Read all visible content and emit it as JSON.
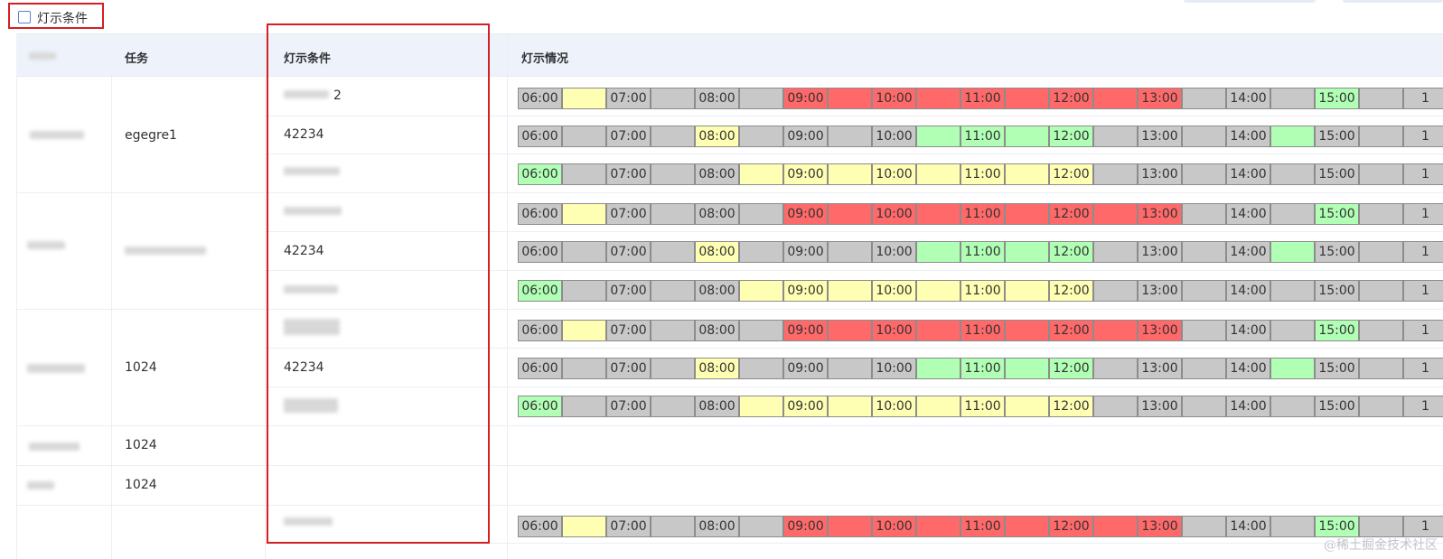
{
  "toggle": {
    "label": "灯示条件",
    "checked": false
  },
  "table": {
    "headers": {
      "task": "任务",
      "condition": "灯示条件",
      "status": "灯示情况"
    },
    "groups": [
      {
        "task": "egegre1",
        "conditions": [
          "2",
          "42234",
          ""
        ]
      },
      {
        "task": "",
        "conditions": [
          "",
          "42234",
          ""
        ]
      },
      {
        "task": "1024",
        "conditions": [
          "",
          "42234",
          ""
        ]
      },
      {
        "task": "1024",
        "conditions": []
      },
      {
        "task": "1024",
        "conditions": []
      },
      {
        "task": "",
        "conditions": [
          ""
        ]
      }
    ]
  },
  "light_patterns": {
    "A": {
      "times": [
        "06:00",
        "",
        "07:00",
        "",
        "08:00",
        "",
        "09:00",
        "",
        "10:00",
        "",
        "11:00",
        "",
        "12:00",
        "",
        "13:00",
        "",
        "14:00",
        "",
        "15:00",
        "",
        "1"
      ],
      "colors": [
        "grey",
        "yellow",
        "grey",
        "grey",
        "grey",
        "grey",
        "red",
        "red",
        "red",
        "red",
        "red",
        "red",
        "red",
        "red",
        "red",
        "grey",
        "grey",
        "grey",
        "green",
        "grey",
        "grey"
      ]
    },
    "B": {
      "times": [
        "06:00",
        "",
        "07:00",
        "",
        "08:00",
        "",
        "09:00",
        "",
        "10:00",
        "",
        "11:00",
        "",
        "12:00",
        "",
        "13:00",
        "",
        "14:00",
        "",
        "15:00",
        "",
        "1"
      ],
      "colors": [
        "grey",
        "grey",
        "grey",
        "grey",
        "yellow",
        "grey",
        "grey",
        "grey",
        "grey",
        "green",
        "green",
        "green",
        "green",
        "grey",
        "grey",
        "grey",
        "grey",
        "green",
        "grey",
        "grey",
        "grey"
      ]
    },
    "C": {
      "times": [
        "06:00",
        "",
        "07:00",
        "",
        "08:00",
        "",
        "09:00",
        "",
        "10:00",
        "",
        "11:00",
        "",
        "12:00",
        "",
        "13:00",
        "",
        "14:00",
        "",
        "15:00",
        "",
        "1"
      ],
      "colors": [
        "green",
        "grey",
        "grey",
        "grey",
        "grey",
        "yellow",
        "yellow",
        "yellow",
        "yellow",
        "yellow",
        "yellow",
        "yellow",
        "yellow",
        "grey",
        "grey",
        "grey",
        "grey",
        "grey",
        "grey",
        "grey",
        "grey"
      ]
    }
  },
  "colors": {
    "grey": "#c8c8c8",
    "yellow": "#ffffb3",
    "red": "#ff6969",
    "green": "#b0ffb5",
    "highlight": "#d41f24"
  },
  "watermark": "@稀土掘金技术社区"
}
